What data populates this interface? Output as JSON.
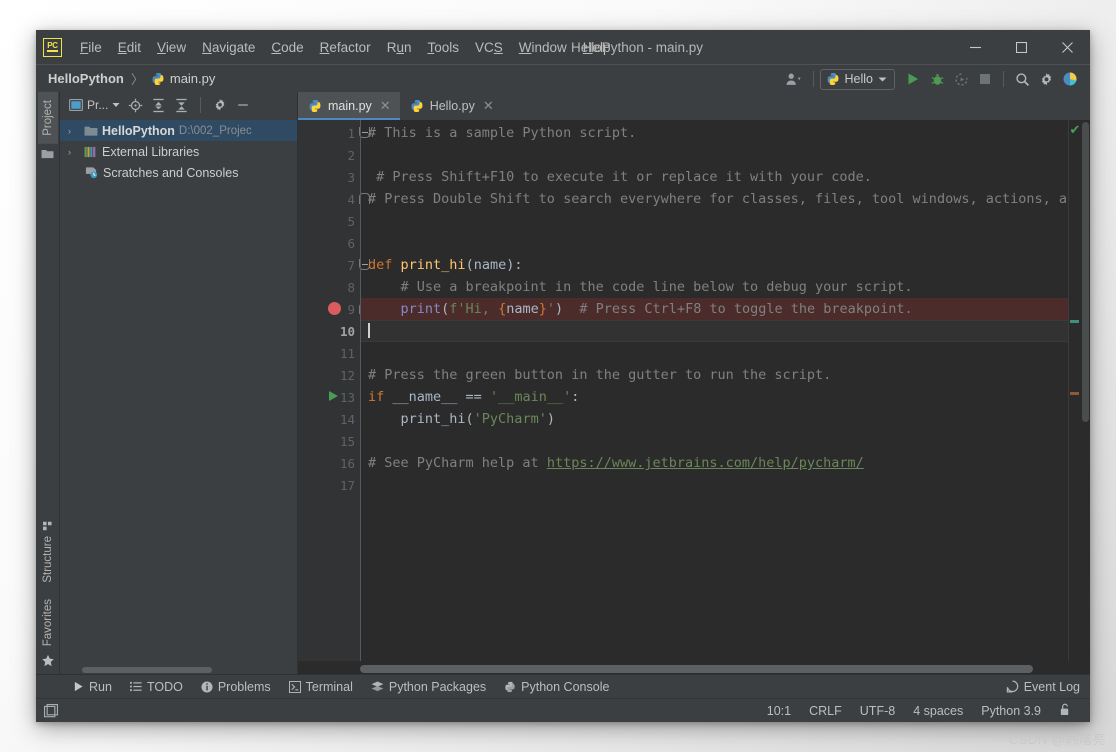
{
  "window": {
    "title": "HelloPython - main.py",
    "logo_text": "PC",
    "minimize_label": "—",
    "maximize_label": "☐",
    "close_label": "✕"
  },
  "menubar": {
    "items": [
      {
        "label": "File",
        "mnemonic": "F"
      },
      {
        "label": "Edit",
        "mnemonic": "E"
      },
      {
        "label": "View",
        "mnemonic": "V"
      },
      {
        "label": "Navigate",
        "mnemonic": "N"
      },
      {
        "label": "Code",
        "mnemonic": "C"
      },
      {
        "label": "Refactor",
        "mnemonic": "R"
      },
      {
        "label": "Run",
        "mnemonic": "u"
      },
      {
        "label": "Tools",
        "mnemonic": "T"
      },
      {
        "label": "VCS",
        "mnemonic": "S"
      },
      {
        "label": "Window",
        "mnemonic": "W"
      },
      {
        "label": "Help",
        "mnemonic": "H"
      }
    ]
  },
  "navbar": {
    "project_crumb": "HelloPython",
    "separator": "〉",
    "file_crumb": "main.py",
    "run_config_label": "Hello",
    "icons": {
      "user": "user-settings-icon",
      "run": "run-icon",
      "debug": "debug-icon",
      "coverage": "run-coverage-icon",
      "stop": "stop-icon",
      "search": "search-everywhere-icon",
      "settings": "settings-icon",
      "updates": "updates-icon"
    }
  },
  "left_rail": {
    "top": [
      {
        "label": "Project",
        "active": true
      }
    ],
    "bottom": [
      {
        "label": "Structure",
        "active": false
      },
      {
        "label": "Favorites",
        "active": false
      }
    ]
  },
  "project_panel": {
    "selector_label": "Pr...",
    "toolbar_icons": [
      "locate-icon",
      "expand-all-icon",
      "collapse-all-icon",
      "settings-icon",
      "hide-icon"
    ],
    "tree": [
      {
        "arrow": "›",
        "label": "HelloPython",
        "path": "D:\\002_Projec",
        "bold": true,
        "selected": true,
        "icon": "folder-icon"
      },
      {
        "arrow": "›",
        "label": "External Libraries",
        "path": "",
        "bold": false,
        "selected": false,
        "icon": "libraries-icon"
      },
      {
        "arrow": "",
        "label": "Scratches and Consoles",
        "path": "",
        "bold": false,
        "selected": false,
        "icon": "scratches-icon"
      }
    ]
  },
  "editor": {
    "tabs": [
      {
        "label": "main.py",
        "active": true,
        "icon": "python-file-icon"
      },
      {
        "label": "Hello.py",
        "active": false,
        "icon": "python-file-icon"
      }
    ],
    "inspection_status": "✔",
    "lines": [
      {
        "n": 1,
        "fold": "open",
        "marker": "",
        "state": "",
        "tokens": [
          {
            "t": "cm",
            "v": "# This is a sample Python script."
          }
        ]
      },
      {
        "n": 2,
        "fold": "",
        "marker": "",
        "state": "",
        "tokens": []
      },
      {
        "n": 3,
        "fold": "",
        "marker": "",
        "state": "",
        "tokens": [
          {
            "t": "cm",
            "v": " # Press Shift+F10 to execute it or replace it with your code."
          }
        ]
      },
      {
        "n": 4,
        "fold": "closebot",
        "marker": "",
        "state": "",
        "tokens": [
          {
            "t": "cm",
            "v": "# Press Double Shift to search everywhere for classes, files, tool windows, actions, and setti"
          }
        ]
      },
      {
        "n": 5,
        "fold": "",
        "marker": "",
        "state": "",
        "tokens": []
      },
      {
        "n": 6,
        "fold": "",
        "marker": "",
        "state": "",
        "tokens": []
      },
      {
        "n": 7,
        "fold": "open",
        "marker": "",
        "state": "",
        "tokens": [
          {
            "t": "kw",
            "v": "def"
          },
          {
            "t": "pm",
            "v": " "
          },
          {
            "t": "fn",
            "v": "print_hi"
          },
          {
            "t": "pm",
            "v": "(name):"
          }
        ]
      },
      {
        "n": 8,
        "fold": "",
        "marker": "",
        "state": "",
        "tokens": [
          {
            "t": "cm",
            "v": "    # Use a breakpoint in the code line below to debug your script."
          }
        ]
      },
      {
        "n": 9,
        "fold": "closebot",
        "marker": "breakpoint",
        "state": "bp",
        "tokens": [
          {
            "t": "pm",
            "v": "    "
          },
          {
            "t": "bi",
            "v": "print"
          },
          {
            "t": "pm",
            "v": "("
          },
          {
            "t": "str",
            "v": "f'Hi, "
          },
          {
            "t": "brc",
            "v": "{"
          },
          {
            "t": "pm",
            "v": "name"
          },
          {
            "t": "brc",
            "v": "}"
          },
          {
            "t": "str",
            "v": "'"
          },
          {
            "t": "pm",
            "v": ")  "
          },
          {
            "t": "cm",
            "v": "# Press Ctrl+F8 to toggle the breakpoint."
          }
        ]
      },
      {
        "n": 10,
        "fold": "",
        "marker": "",
        "state": "cur",
        "tokens": [],
        "cursor": true
      },
      {
        "n": 11,
        "fold": "",
        "marker": "",
        "state": "",
        "tokens": []
      },
      {
        "n": 12,
        "fold": "",
        "marker": "",
        "state": "",
        "tokens": [
          {
            "t": "cm",
            "v": "# Press the green button in the gutter to run the script."
          }
        ]
      },
      {
        "n": 13,
        "fold": "",
        "marker": "run",
        "state": "",
        "tokens": [
          {
            "t": "kw",
            "v": "if"
          },
          {
            "t": "pm",
            "v": " __name__ == "
          },
          {
            "t": "str",
            "v": "'__main__'"
          },
          {
            "t": "pm",
            "v": ":"
          }
        ]
      },
      {
        "n": 14,
        "fold": "",
        "marker": "",
        "state": "",
        "tokens": [
          {
            "t": "pm",
            "v": "    print_hi("
          },
          {
            "t": "str",
            "v": "'PyCharm'"
          },
          {
            "t": "pm",
            "v": ")"
          }
        ]
      },
      {
        "n": 15,
        "fold": "",
        "marker": "",
        "state": "",
        "tokens": []
      },
      {
        "n": 16,
        "fold": "",
        "marker": "",
        "state": "",
        "tokens": [
          {
            "t": "cm",
            "v": "# See PyCharm help at "
          },
          {
            "t": "lnk",
            "v": "https://www.jetbrains.com/help/pycharm/"
          }
        ]
      },
      {
        "n": 17,
        "fold": "",
        "marker": "",
        "state": "",
        "tokens": []
      }
    ]
  },
  "bottom_tools": {
    "items": [
      {
        "label": "Run",
        "icon": "run-icon"
      },
      {
        "label": "TODO",
        "icon": "todo-icon"
      },
      {
        "label": "Problems",
        "icon": "problems-icon"
      },
      {
        "label": "Terminal",
        "icon": "terminal-icon"
      },
      {
        "label": "Python Packages",
        "icon": "packages-icon"
      },
      {
        "label": "Python Console",
        "icon": "python-console-icon"
      }
    ],
    "event_log": "Event Log"
  },
  "statusbar": {
    "caret": "10:1",
    "line_ending": "CRLF",
    "encoding": "UTF-8",
    "indent": "4 spaces",
    "interpreter": "Python 3.9",
    "lock_icon": "unlocked-icon"
  },
  "watermark": "CSDN @韩曙亮",
  "colors": {
    "window_chrome": "#3c3f41",
    "editor_bg": "#2b2b2b",
    "gutter_bg": "#313335",
    "tab_active": "#4e5254",
    "tab_underline": "#4a88c7",
    "tree_selected": "#2f4a63",
    "breakpoint_line": "#4c2b2b",
    "breakpoint_dot": "#db5c5c",
    "run_green": "#499c54",
    "comment": "#808080",
    "keyword": "#cc7832",
    "function": "#ffc66d",
    "string": "#6a8759",
    "builtin": "#8888c6",
    "default_text": "#a9b7c6",
    "logo_yellow": "#f0e24a"
  }
}
